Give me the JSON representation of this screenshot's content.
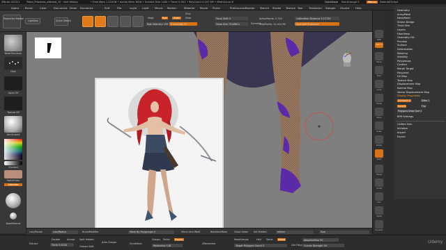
{
  "title_bar": {
    "app": "ZBrush 2023.2",
    "file": "Tribal_Priestess_afthead_10 · Hair History",
    "stats": "• Free Mem 1.515GB • Active Mem 3818 • Scratch Disk 1430 • Timer 0.001 • PolyCount 0.207 MP • MeshCount 8",
    "quicksave": "QuickSave",
    "see_through": "See-through 0",
    "menus_btn": "Menus",
    "script": "DefaultZScript"
  },
  "menu_bar": [
    "Alpha",
    "Brush",
    "Color",
    "Document",
    "Draw",
    "Dynamics",
    "Edit",
    "File",
    "Layer",
    "Light",
    "Macro",
    "Marker",
    "Material",
    "Movie",
    "Picker",
    "Preferences",
    "Render",
    "Stencil",
    "Stroke",
    "Texture",
    "Tool",
    "Transform",
    "Zplugin",
    "Zscript",
    "Help"
  ],
  "top_shelf": {
    "projection_master": "Projection Master",
    "lightbox": "LightBox",
    "quick_sketch": "Quick Sketch",
    "edit": "Edit",
    "draw": "Draw",
    "move": "Move",
    "scale": "Scale",
    "rotate": "Rotate",
    "mrgb": "Mrgb",
    "rgb": "Rgb",
    "m": "M",
    "rgb_intensity": "Rgb Intensity 100",
    "zadd": "Zadd",
    "zsub": "Zsub",
    "zcut": "Zcut",
    "z_intensity": "Z Intensity 51",
    "focal_shift": "Focal Shift 0",
    "draw_size": "Draw Size 73.88811",
    "dynamic": "Dynamic",
    "active_points": "ActivePoints: 2,729",
    "total_points": "TotalPoints: 22,414 Mil",
    "calibration": "Calibration Distance 3.12729",
    "spotlight": "Spotlight Projection"
  },
  "left_shelf": {
    "brush_label": "NoiseTransform",
    "dots_label": "Dots",
    "alpha_label": "Alpha Off",
    "texture_label": "Texture Off",
    "material_label": "SkinShade4",
    "gradient_label": "Gradient",
    "switch_color": "SwitchColor",
    "alternate": "Alternate",
    "base_material": "BaseMaterial"
  },
  "right_dock": {
    "bpr": "BPR",
    "spix": "SPix 3",
    "persp": "Persp",
    "floor": "Floor",
    "local": "Local",
    "frame": "Frame",
    "move": "Move",
    "scale": "Scale",
    "rotate": "Rotate",
    "polyf": "PolyF",
    "transp": "Transp",
    "ghost": "Ghost",
    "solo": "Solo",
    "xpose": "Xpose",
    "dynamic": "Dynamic"
  },
  "tool_menu": {
    "items": [
      "Geometry",
      "ArrayMesh",
      "NanoMesh",
      "Stroke Bridge",
      "Thick Skin",
      "Layers",
      "FiberMesh",
      "Geometry HD",
      "Preview",
      "Surface",
      "Deformation",
      "Masking",
      "Visibility",
      "Polygroups",
      "Contact",
      "Morph Target",
      "Polypaint",
      "UV Map",
      "Texture Map",
      "Displacement Map",
      "Normal Map",
      "Vector Displacement Map",
      "Display Properties"
    ],
    "dp_smooth": "DSmooth 0",
    "dp_dres": "DRes 1",
    "dp_bp": "BPR",
    "double": "Double",
    "flip": "Flip",
    "polygon_draw_size": "Polygons Draw Size 1",
    "bpr_settings": "BPR Settings",
    "unified_skin": "Unified Skin",
    "initialize": "Initialize",
    "import": "Import",
    "export": "Export"
  },
  "bottom_shelf1": {
    "lazy_mouse": "LazyMouse",
    "lazy_radius": "LazyRadius",
    "backface": "BrushModifier",
    "mask_by_polygroups": "Mask By Polygroups 0",
    "mirror_weld": "Mirror And Weld",
    "backface_mask": "BackfaceMask",
    "close_holes": "Close Holes",
    "del_hidden": "Del Hidden",
    "inflate": "Inflate",
    "size": "Size"
  },
  "bottom_shelf2": {
    "extract": "Extract",
    "double": "Double",
    "thick": "Thick 0.0016",
    "accept": "Accept",
    "split_hidden": "Split Hidden",
    "groups_split": "Groups Split",
    "auto_groups": "Auto Groups",
    "dynamesh": "DynaMesh",
    "groups": "Groups",
    "polish": "Polish",
    "project": "Project",
    "resolution": "Resolution 128",
    "zremesher": "ZRemesher",
    "keep_groups": "KeepGroups",
    "half": "Half",
    "same": "Same",
    "adapt": "Adapt",
    "target_polygons": "Target Polygons Count 5",
    "use_polypaint": "Use Polypaint",
    "adaptive_size": "AdaptiveSize 50",
    "curves_strength": "Curves Strength 50"
  },
  "watermark": "Udemy",
  "colors": {
    "accent": "#e27a1a",
    "viewport_bg": "#7f7f7f",
    "polypaint_purple": "#5b2aa8",
    "leg_skin": "#9c7b63",
    "skirt": "#3a3550"
  }
}
